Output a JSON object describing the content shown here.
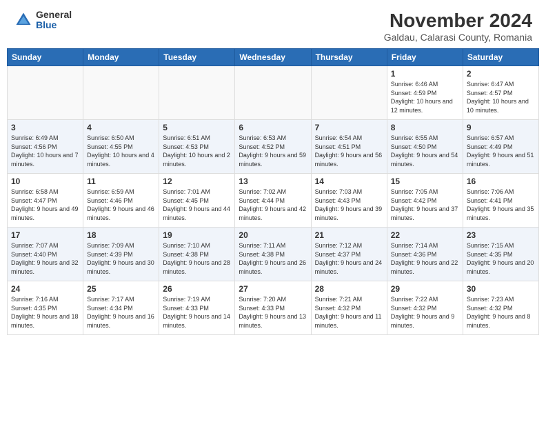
{
  "header": {
    "logo_general": "General",
    "logo_blue": "Blue",
    "month_title": "November 2024",
    "subtitle": "Galdau, Calarasi County, Romania"
  },
  "days_of_week": [
    "Sunday",
    "Monday",
    "Tuesday",
    "Wednesday",
    "Thursday",
    "Friday",
    "Saturday"
  ],
  "weeks": [
    {
      "shaded": false,
      "days": [
        {
          "num": "",
          "info": ""
        },
        {
          "num": "",
          "info": ""
        },
        {
          "num": "",
          "info": ""
        },
        {
          "num": "",
          "info": ""
        },
        {
          "num": "",
          "info": ""
        },
        {
          "num": "1",
          "info": "Sunrise: 6:46 AM\nSunset: 4:59 PM\nDaylight: 10 hours\nand 12 minutes."
        },
        {
          "num": "2",
          "info": "Sunrise: 6:47 AM\nSunset: 4:57 PM\nDaylight: 10 hours\nand 10 minutes."
        }
      ]
    },
    {
      "shaded": true,
      "days": [
        {
          "num": "3",
          "info": "Sunrise: 6:49 AM\nSunset: 4:56 PM\nDaylight: 10 hours\nand 7 minutes."
        },
        {
          "num": "4",
          "info": "Sunrise: 6:50 AM\nSunset: 4:55 PM\nDaylight: 10 hours\nand 4 minutes."
        },
        {
          "num": "5",
          "info": "Sunrise: 6:51 AM\nSunset: 4:53 PM\nDaylight: 10 hours\nand 2 minutes."
        },
        {
          "num": "6",
          "info": "Sunrise: 6:53 AM\nSunset: 4:52 PM\nDaylight: 9 hours\nand 59 minutes."
        },
        {
          "num": "7",
          "info": "Sunrise: 6:54 AM\nSunset: 4:51 PM\nDaylight: 9 hours\nand 56 minutes."
        },
        {
          "num": "8",
          "info": "Sunrise: 6:55 AM\nSunset: 4:50 PM\nDaylight: 9 hours\nand 54 minutes."
        },
        {
          "num": "9",
          "info": "Sunrise: 6:57 AM\nSunset: 4:49 PM\nDaylight: 9 hours\nand 51 minutes."
        }
      ]
    },
    {
      "shaded": false,
      "days": [
        {
          "num": "10",
          "info": "Sunrise: 6:58 AM\nSunset: 4:47 PM\nDaylight: 9 hours\nand 49 minutes."
        },
        {
          "num": "11",
          "info": "Sunrise: 6:59 AM\nSunset: 4:46 PM\nDaylight: 9 hours\nand 46 minutes."
        },
        {
          "num": "12",
          "info": "Sunrise: 7:01 AM\nSunset: 4:45 PM\nDaylight: 9 hours\nand 44 minutes."
        },
        {
          "num": "13",
          "info": "Sunrise: 7:02 AM\nSunset: 4:44 PM\nDaylight: 9 hours\nand 42 minutes."
        },
        {
          "num": "14",
          "info": "Sunrise: 7:03 AM\nSunset: 4:43 PM\nDaylight: 9 hours\nand 39 minutes."
        },
        {
          "num": "15",
          "info": "Sunrise: 7:05 AM\nSunset: 4:42 PM\nDaylight: 9 hours\nand 37 minutes."
        },
        {
          "num": "16",
          "info": "Sunrise: 7:06 AM\nSunset: 4:41 PM\nDaylight: 9 hours\nand 35 minutes."
        }
      ]
    },
    {
      "shaded": true,
      "days": [
        {
          "num": "17",
          "info": "Sunrise: 7:07 AM\nSunset: 4:40 PM\nDaylight: 9 hours\nand 32 minutes."
        },
        {
          "num": "18",
          "info": "Sunrise: 7:09 AM\nSunset: 4:39 PM\nDaylight: 9 hours\nand 30 minutes."
        },
        {
          "num": "19",
          "info": "Sunrise: 7:10 AM\nSunset: 4:38 PM\nDaylight: 9 hours\nand 28 minutes."
        },
        {
          "num": "20",
          "info": "Sunrise: 7:11 AM\nSunset: 4:38 PM\nDaylight: 9 hours\nand 26 minutes."
        },
        {
          "num": "21",
          "info": "Sunrise: 7:12 AM\nSunset: 4:37 PM\nDaylight: 9 hours\nand 24 minutes."
        },
        {
          "num": "22",
          "info": "Sunrise: 7:14 AM\nSunset: 4:36 PM\nDaylight: 9 hours\nand 22 minutes."
        },
        {
          "num": "23",
          "info": "Sunrise: 7:15 AM\nSunset: 4:35 PM\nDaylight: 9 hours\nand 20 minutes."
        }
      ]
    },
    {
      "shaded": false,
      "days": [
        {
          "num": "24",
          "info": "Sunrise: 7:16 AM\nSunset: 4:35 PM\nDaylight: 9 hours\nand 18 minutes."
        },
        {
          "num": "25",
          "info": "Sunrise: 7:17 AM\nSunset: 4:34 PM\nDaylight: 9 hours\nand 16 minutes."
        },
        {
          "num": "26",
          "info": "Sunrise: 7:19 AM\nSunset: 4:33 PM\nDaylight: 9 hours\nand 14 minutes."
        },
        {
          "num": "27",
          "info": "Sunrise: 7:20 AM\nSunset: 4:33 PM\nDaylight: 9 hours\nand 13 minutes."
        },
        {
          "num": "28",
          "info": "Sunrise: 7:21 AM\nSunset: 4:32 PM\nDaylight: 9 hours\nand 11 minutes."
        },
        {
          "num": "29",
          "info": "Sunrise: 7:22 AM\nSunset: 4:32 PM\nDaylight: 9 hours\nand 9 minutes."
        },
        {
          "num": "30",
          "info": "Sunrise: 7:23 AM\nSunset: 4:32 PM\nDaylight: 9 hours\nand 8 minutes."
        }
      ]
    }
  ]
}
